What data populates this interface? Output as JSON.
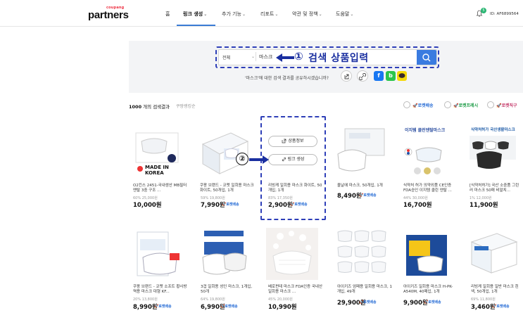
{
  "header": {
    "logo_small": "coupang",
    "logo_big": "partners",
    "nav": [
      {
        "label": "홈",
        "chevron": false
      },
      {
        "label": "링크 생성",
        "chevron": true,
        "active": true
      },
      {
        "label": "추가 기능",
        "chevron": true
      },
      {
        "label": "리포트",
        "chevron": true
      },
      {
        "label": "약관 및 정책",
        "chevron": true
      },
      {
        "label": "도움말",
        "chevron": true
      }
    ],
    "notification_count": "5",
    "user_id": "ID: AF6899564"
  },
  "search": {
    "scope": "전체",
    "query": "마스크",
    "annotation_number": "①",
    "annotation_text": "검색 상품입력",
    "share_text": "'마스크'에 대한 검색 결과를 공유하시겠습니까?",
    "share_icons": [
      "share-icon",
      "link-icon",
      "facebook-icon",
      "band-icon",
      "kakao-icon"
    ]
  },
  "results": {
    "count": "1000",
    "count_suffix": "개의 검색결과",
    "sort_label": "쿠팡랭킹순",
    "filters": [
      "로켓배송",
      "로켓프레시",
      "로켓직구"
    ]
  },
  "overlay": {
    "annotation_number": "②",
    "product_info": "상품정보",
    "link_create": "링크 생성"
  },
  "products": [
    {
      "name": "O2킨스 2451-국내생산 MB필터 멘탈 3중 구조 ...",
      "discount": "60% 25,000원",
      "price": "10,000원",
      "rocket": false,
      "badge_text": "MADE IN KOREA"
    },
    {
      "name": "쿠팡 브랜드 - 코멧 일회용 마스크 화이트, 50개입, 1개",
      "discount": "59% 19,800원",
      "price": "7,990원",
      "rocket": true
    },
    {
      "name": "리빙케 일회용 마스크 화이트, 50개입, 1개",
      "discount": "83% 17,350원",
      "price": "2,900원",
      "rocket": true
    },
    {
      "name": "올날에 마스크, 50개입, 1개",
      "discount": "",
      "price": "8,490원",
      "rocket": true
    },
    {
      "name": "식약처 허가 의약외품 CE인증 FDA승인 이지템 클린 덴탈 ...",
      "discount": "44% 30,000원",
      "price": "16,700원",
      "rocket": false,
      "badge_text": "이지템 클린덴탈마스크"
    },
    {
      "name": "[식약처허가] 국산 소중품 그린러 마스크 50매 비말치...",
      "discount": "1% 12,000원",
      "price": "11,900원",
      "rocket": false,
      "badge_text": "식약처허가 국산생활마스크"
    },
    {
      "name": "쿠팡 브랜드 - 코멧 소프트 황사방역용 마스크 대형 KF...",
      "discount": "20% 13,800원",
      "price": "8,990원",
      "rocket": true
    },
    {
      "name": "3겹 일회용 성인 마스크, 1개입, 50개",
      "discount": "64% 19,800원",
      "price": "6,990원",
      "rocket": true
    },
    {
      "name": "베로펀테 마스크 FDA인증 국내산 일회용 마스크 ...",
      "discount": "45% 20,000원",
      "price": "10,990원",
      "rocket": false
    },
    {
      "name": "아이키즈 엄패용 일회용 마스크, 1개입, 49개",
      "discount": "",
      "price": "29,900원",
      "rocket": true
    },
    {
      "name": "아이키즈 일회용 마스크 H-PK-A540M, 40매입, 1개",
      "discount": "",
      "price": "9,900원",
      "rocket": true
    },
    {
      "name": "리빙케 일회용 일반 마스크 흰색, 50개입, 1개",
      "discount": "69% 11,800원",
      "price": "3,460원",
      "rocket": true
    }
  ],
  "colors": {
    "accent": "#3a7be0",
    "annotation": "#2e3fb8",
    "rocket": "#2b6fd6"
  }
}
